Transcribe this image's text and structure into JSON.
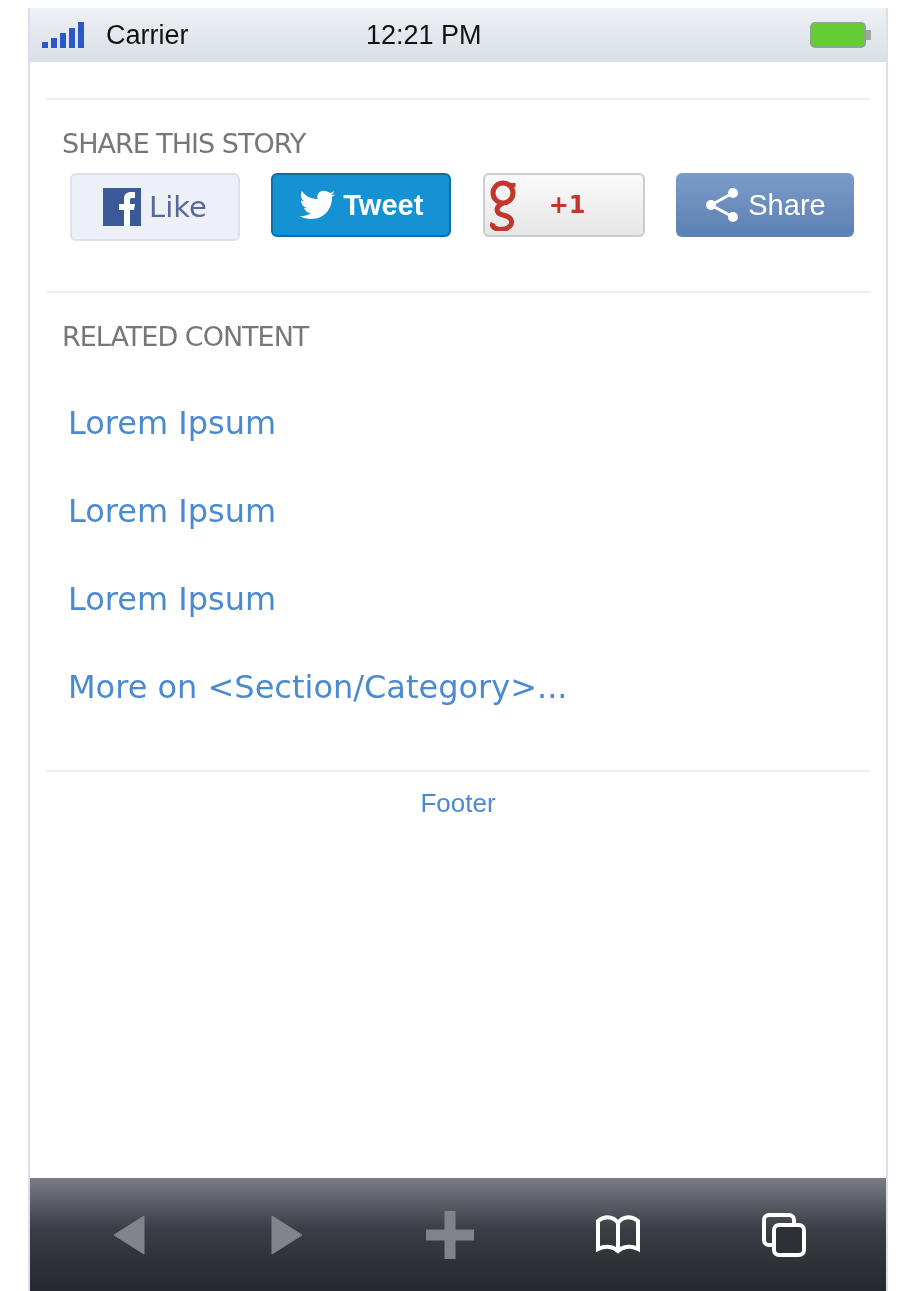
{
  "status_bar": {
    "carrier": "Carrier",
    "time": "12:21 PM"
  },
  "share": {
    "heading": "SHARE THIS STORY",
    "buttons": [
      {
        "kind": "facebook",
        "label": "Like"
      },
      {
        "kind": "twitter",
        "label": "Tweet"
      },
      {
        "kind": "google",
        "label": "+1"
      },
      {
        "kind": "share",
        "label": "Share"
      }
    ]
  },
  "related": {
    "heading": "RELATED CONTENT",
    "links": [
      "Lorem Ipsum",
      "Lorem Ipsum",
      "Lorem Ipsum",
      "More on <Section/Category>..."
    ]
  },
  "footer": "Footer",
  "toolbar": [
    {
      "kind": "back",
      "disabled": true
    },
    {
      "kind": "forward",
      "disabled": true
    },
    {
      "kind": "add",
      "disabled": true
    },
    {
      "kind": "bookmarks",
      "disabled": false
    },
    {
      "kind": "tabs",
      "disabled": false
    }
  ]
}
